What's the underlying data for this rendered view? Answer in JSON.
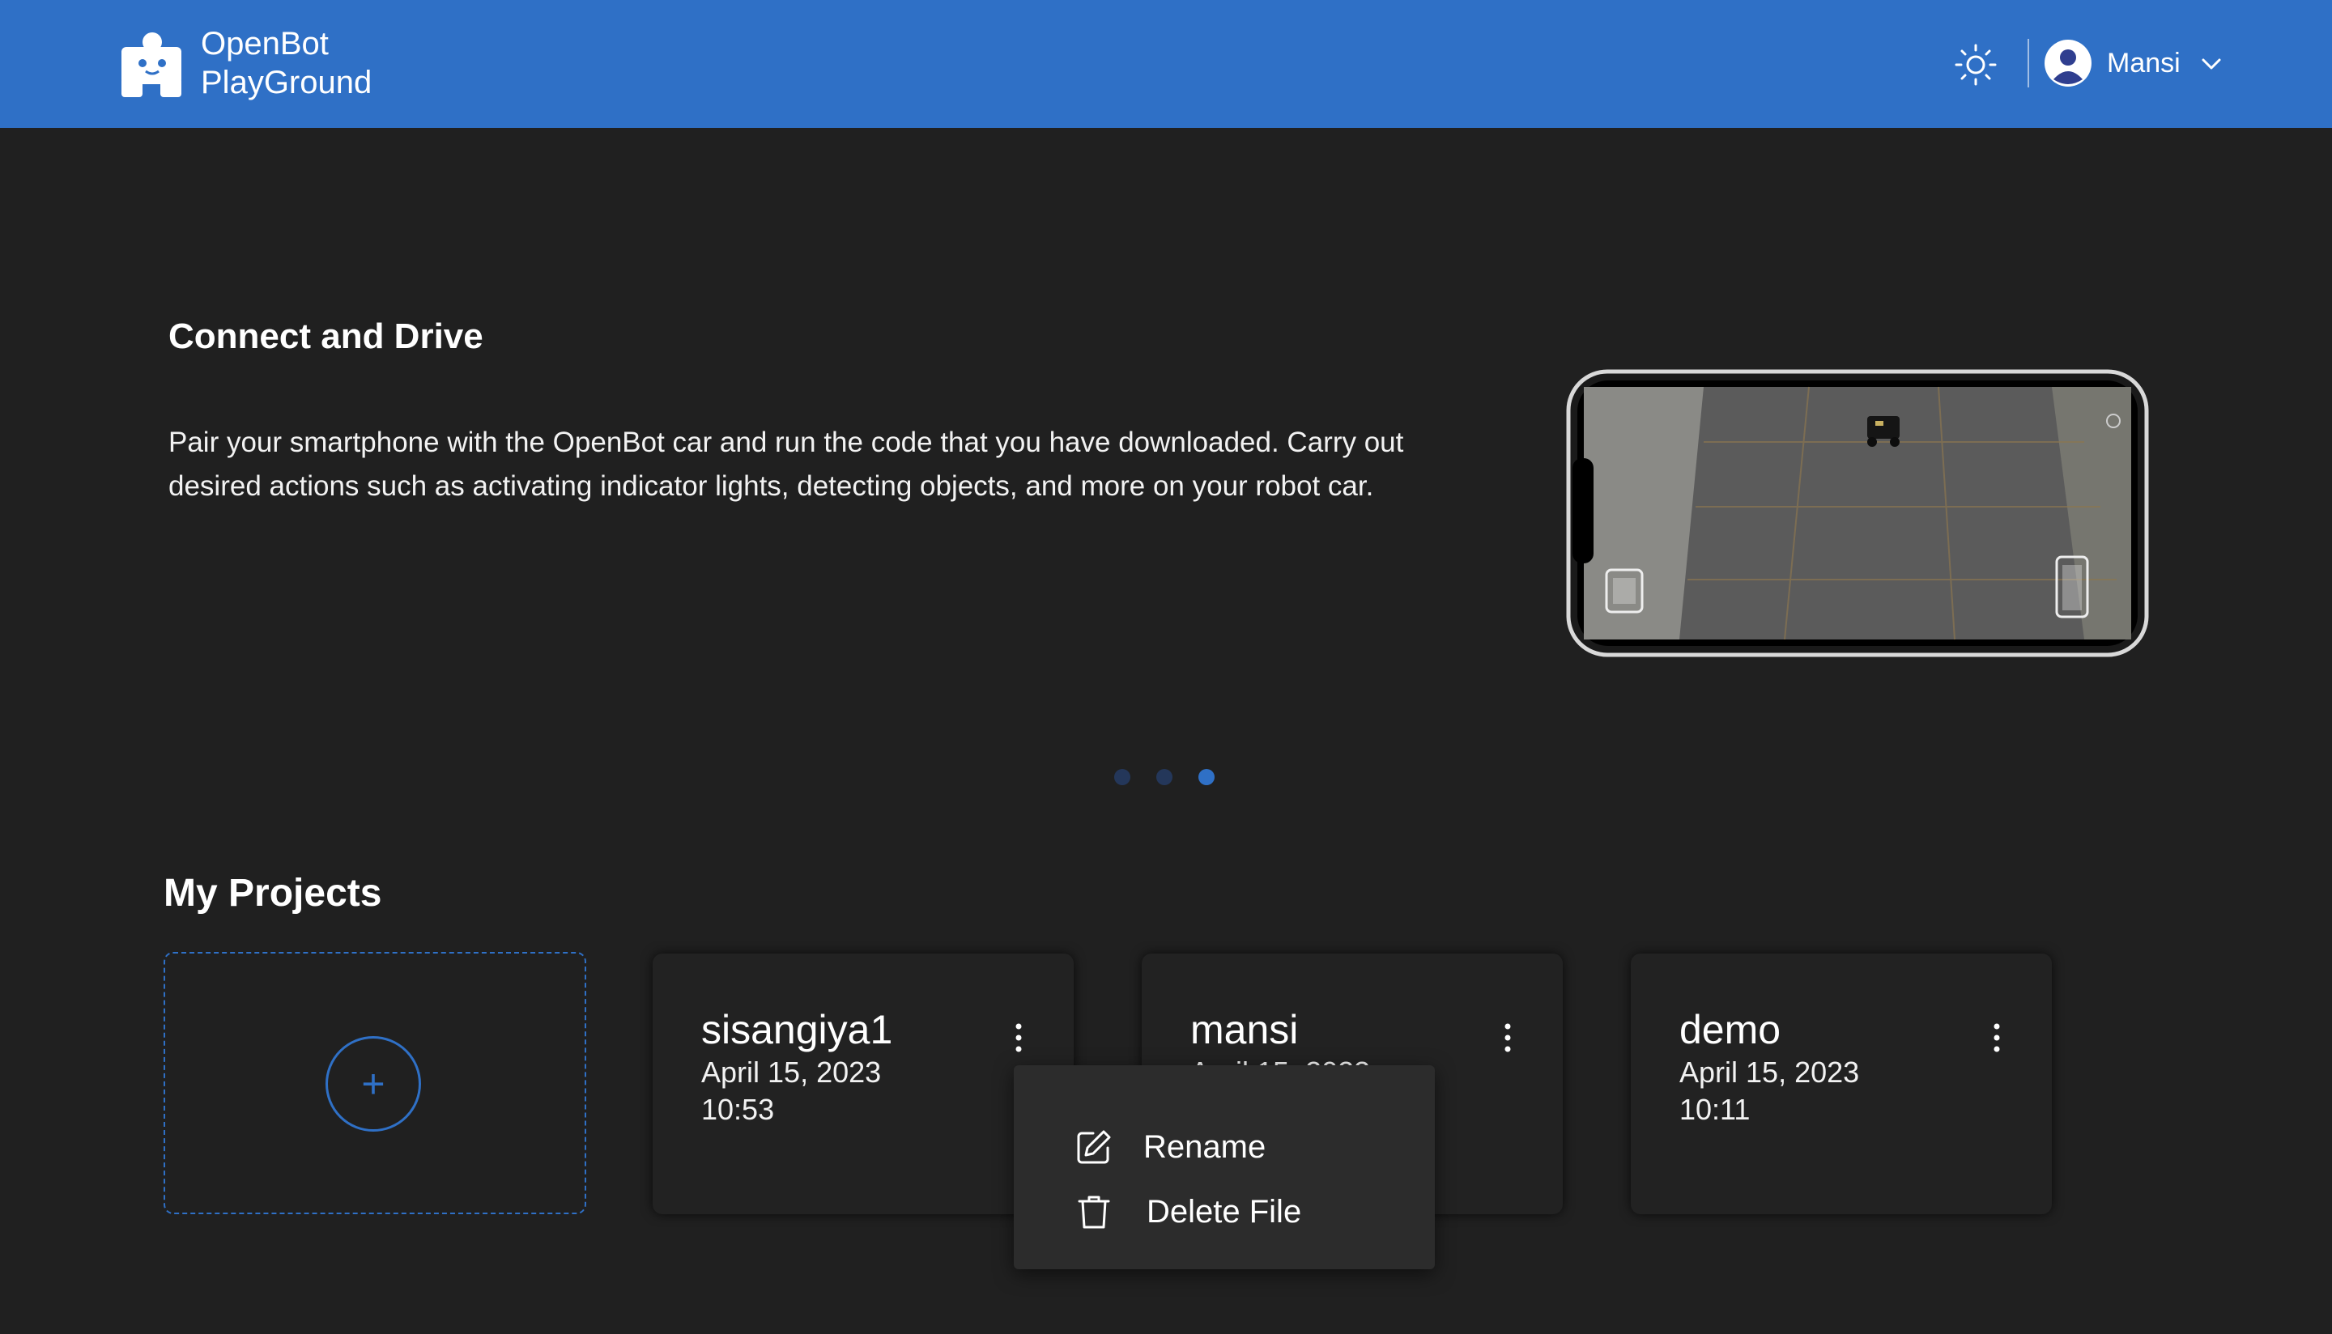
{
  "header": {
    "brand_line1": "OpenBot",
    "brand_line2": "PlayGround",
    "user_name": "Mansi",
    "background_color": "#2f70c6"
  },
  "carousel": {
    "title": "Connect and Drive",
    "description": "Pair your smartphone with the OpenBot car and run the code that you have downloaded. Carry out desired actions such as activating indicator lights, detecting objects, and more on your robot car.",
    "dots_total": 3,
    "active_dot": 3
  },
  "projects": {
    "title": "My Projects",
    "new_project_icon": "+",
    "items": [
      {
        "name": "sisangiya1",
        "date": "April 15, 2023",
        "time": "10:53"
      },
      {
        "name": "mansi",
        "date": "April 15, 2023",
        "time": ""
      },
      {
        "name": "demo",
        "date": "April 15, 2023",
        "time": "10:11"
      }
    ]
  },
  "context_menu": {
    "rename_label": "Rename",
    "delete_label": "Delete File"
  },
  "icons": {
    "logo": "openbot-logo-icon",
    "theme": "sun-icon",
    "avatar": "user-avatar-icon",
    "chevron": "chevron-down-icon",
    "more": "more-vertical-icon",
    "rename": "edit-icon",
    "delete": "trash-icon"
  },
  "colors": {
    "accent": "#2f70c6",
    "background": "#202020",
    "card": "#222222",
    "menu": "#2c2c2c"
  }
}
